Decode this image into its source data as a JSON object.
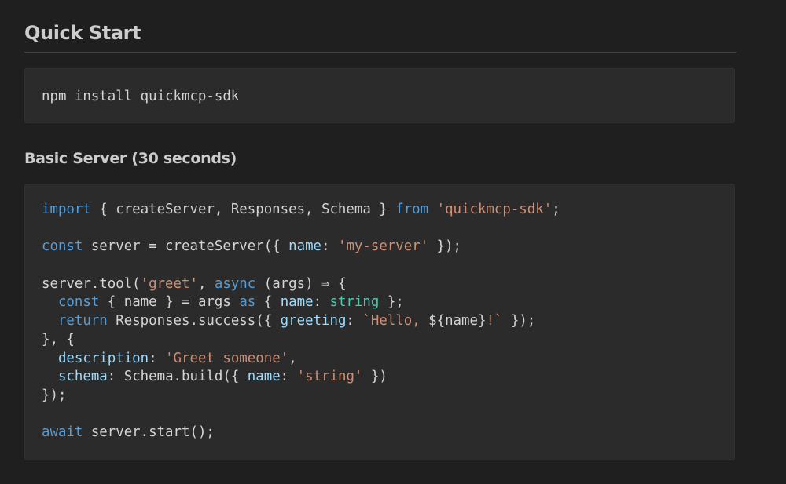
{
  "quick_start": {
    "title": "Quick Start",
    "install_command": "npm install quickmcp-sdk"
  },
  "basic_server": {
    "title": "Basic Server (30 seconds)",
    "code_lines": [
      [
        [
          "kw",
          "import"
        ],
        [
          "plain",
          " { createServer, Responses, Schema } "
        ],
        [
          "kw",
          "from"
        ],
        [
          "plain",
          " "
        ],
        [
          "str",
          "'quickmcp-sdk'"
        ],
        [
          "plain",
          ";"
        ]
      ],
      [],
      [
        [
          "kw",
          "const"
        ],
        [
          "plain",
          " server = createServer({ "
        ],
        [
          "prop",
          "name"
        ],
        [
          "plain",
          ": "
        ],
        [
          "str",
          "'my-server'"
        ],
        [
          "plain",
          " });"
        ]
      ],
      [],
      [
        [
          "plain",
          "server.tool("
        ],
        [
          "str",
          "'greet'"
        ],
        [
          "plain",
          ", "
        ],
        [
          "kw",
          "async"
        ],
        [
          "plain",
          " (args) ⇒ {"
        ]
      ],
      [
        [
          "plain",
          "  "
        ],
        [
          "kw",
          "const"
        ],
        [
          "plain",
          " { name } = args "
        ],
        [
          "kw",
          "as"
        ],
        [
          "plain",
          " { "
        ],
        [
          "prop",
          "name"
        ],
        [
          "plain",
          ": "
        ],
        [
          "type",
          "string"
        ],
        [
          "plain",
          " };"
        ]
      ],
      [
        [
          "plain",
          "  "
        ],
        [
          "kw",
          "return"
        ],
        [
          "plain",
          " Responses.success({ "
        ],
        [
          "prop",
          "greeting"
        ],
        [
          "plain",
          ": "
        ],
        [
          "str",
          "`Hello, "
        ],
        [
          "plain",
          "${name}"
        ],
        [
          "str",
          "!`"
        ],
        [
          "plain",
          " });"
        ]
      ],
      [
        [
          "plain",
          "}, {"
        ]
      ],
      [
        [
          "plain",
          "  "
        ],
        [
          "prop",
          "description"
        ],
        [
          "plain",
          ": "
        ],
        [
          "str",
          "'Greet someone'"
        ],
        [
          "plain",
          ","
        ]
      ],
      [
        [
          "plain",
          "  "
        ],
        [
          "prop",
          "schema"
        ],
        [
          "plain",
          ": Schema.build({ "
        ],
        [
          "prop",
          "name"
        ],
        [
          "plain",
          ": "
        ],
        [
          "str",
          "'string'"
        ],
        [
          "plain",
          " })"
        ]
      ],
      [
        [
          "plain",
          "});"
        ]
      ],
      [],
      [
        [
          "kw",
          "await"
        ],
        [
          "plain",
          " server.start();"
        ]
      ]
    ]
  },
  "colors": {
    "background": "#1f1f1f",
    "code_background": "#2b2b2b",
    "keyword": "#569cd6",
    "string": "#ce9178",
    "property": "#9cdcfe",
    "type": "#4ec9b0",
    "text": "#d4d4d4"
  }
}
